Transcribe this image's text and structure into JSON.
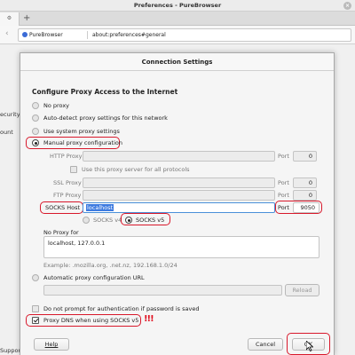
{
  "window": {
    "title": "Preferences - PureBrowser",
    "close_glyph": "×"
  },
  "tabs": {
    "new_tab_glyph": "+"
  },
  "urlbar": {
    "identity": "PureBrowser",
    "url": "about:preferences#general"
  },
  "background": {
    "fragment1": "ecurity",
    "fragment2": "ount",
    "fragment3": "Support"
  },
  "dialog": {
    "title": "Connection Settings",
    "heading": "Configure Proxy Access to the Internet",
    "options": {
      "no_proxy": "No proxy",
      "auto_detect": "Auto-detect proxy settings for this network",
      "system": "Use system proxy settings",
      "manual": "Manual proxy configuration",
      "auto_url": "Automatic proxy configuration URL"
    },
    "selected_option": "manual",
    "http": {
      "label": "HTTP Proxy",
      "host": "",
      "port_label": "Port",
      "port": "0"
    },
    "use_for_all": {
      "label": "Use this proxy server for all protocols",
      "checked": false
    },
    "ssl": {
      "label": "SSL Proxy",
      "host": "",
      "port_label": "Port",
      "port": "0"
    },
    "ftp": {
      "label": "FTP Proxy",
      "host": "",
      "port_label": "Port",
      "port": "0"
    },
    "socks": {
      "label": "SOCKS Host",
      "host": "localhost",
      "port_label": "Port",
      "port": "9050"
    },
    "socks_version": {
      "v4": "SOCKS v4",
      "v5": "SOCKS v5",
      "selected": "v5"
    },
    "no_proxy_for": {
      "label": "No Proxy for",
      "value": "localhost, 127.0.0.1"
    },
    "example": "Example: .mozilla.org, .net.nz, 192.168.1.0/24",
    "auto_url_value": "",
    "reload_label": "Reload",
    "no_prompt_auth": {
      "label": "Do not prompt for authentication if password is saved",
      "checked": false
    },
    "proxy_dns": {
      "label": "Proxy DNS when using SOCKS v5",
      "checked": true
    },
    "annotation": "!!!",
    "help_label": "Help",
    "cancel_label": "Cancel",
    "ok_label": "OK"
  },
  "colors": {
    "highlight_ring": "#d8182b",
    "selection": "#3d7be0"
  }
}
